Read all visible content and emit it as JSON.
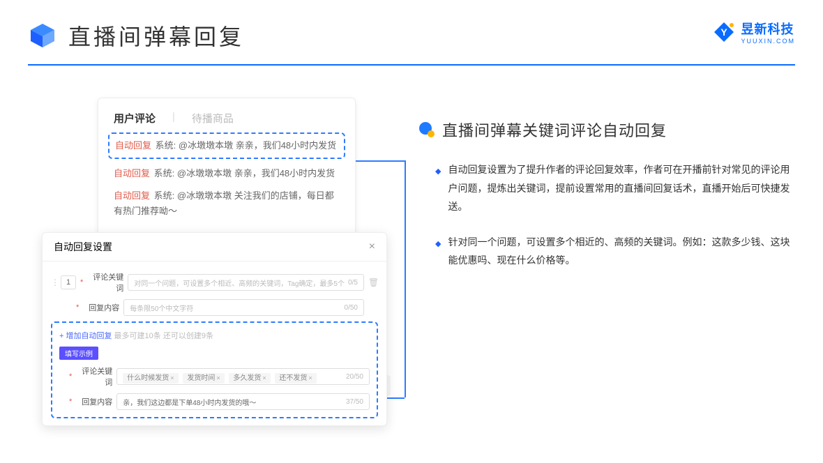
{
  "header": {
    "title": "直播间弹幕回复"
  },
  "brand": {
    "name": "昱新科技",
    "sub": "YUUXIN.COM"
  },
  "comments": {
    "tabs": {
      "active": "用户评论",
      "idle": "待播商品"
    },
    "items": [
      {
        "tag": "自动回复",
        "prefix": "系统:",
        "text": "@冰墩墩本墩 亲亲，我们48小时内发货",
        "boxed": true
      },
      {
        "tag": "自动回复",
        "prefix": "系统:",
        "text": "@冰墩墩本墩 亲亲，我们48小时内发货",
        "boxed": false
      },
      {
        "tag": "自动回复",
        "prefix": "系统:",
        "text": "@冰墩墩本墩 关注我们的店铺，每日都有热门推荐呦～",
        "boxed": false
      }
    ]
  },
  "settings": {
    "title": "自动回复设置",
    "index": "1",
    "rows": {
      "kw": {
        "label": "评论关键词",
        "placeholder": "对同一个问题，可设置多个相近、高频的关键词，Tag确定，最多5个",
        "count": "0/5"
      },
      "reply": {
        "label": "回复内容",
        "placeholder": "每条限50个中文字符",
        "count": "0/50"
      }
    },
    "add": {
      "link": "+ 增加自动回复",
      "hint": "最多可建10条 还可以创建9条"
    },
    "example": {
      "badge": "填写示例",
      "kw_label": "评论关键词",
      "tags": [
        "什么时候发货",
        "发货时间",
        "多久发货",
        "还不发货"
      ],
      "kw_count": "20/50",
      "reply_label": "回复内容",
      "reply_text": "亲，我们这边都是下单48小时内发货的哦～",
      "reply_count": "37/50"
    },
    "under_count": "/50"
  },
  "right": {
    "section": "直播间弹幕关键词评论自动回复",
    "bullets": [
      "自动回复设置为了提升作者的评论回复效率，作者可在开播前针对常见的评论用户问题，提炼出关键词，提前设置常用的直播间回复话术，直播开始后可快捷发送。",
      "针对同一个问题，可设置多个相近的、高频的关键词。例如：这款多少钱、这块能优惠吗、现在什么价格等。"
    ]
  }
}
